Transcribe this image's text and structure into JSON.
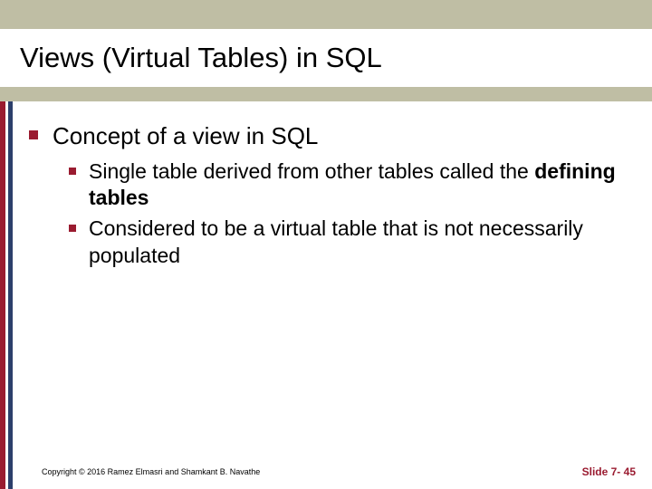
{
  "title": "Views (Virtual Tables) in SQL",
  "bullets": {
    "lvl1": "Concept of a view in SQL",
    "lvl2a_pre": "Single table derived from other tables called the ",
    "lvl2a_bold": "defining tables",
    "lvl2b": "Considered to be a virtual table that is not necessarily populated"
  },
  "footer": {
    "copyright": "Copyright © 2016 Ramez Elmasri and Shamkant B. Navathe",
    "slide": "Slide 7- 45"
  }
}
